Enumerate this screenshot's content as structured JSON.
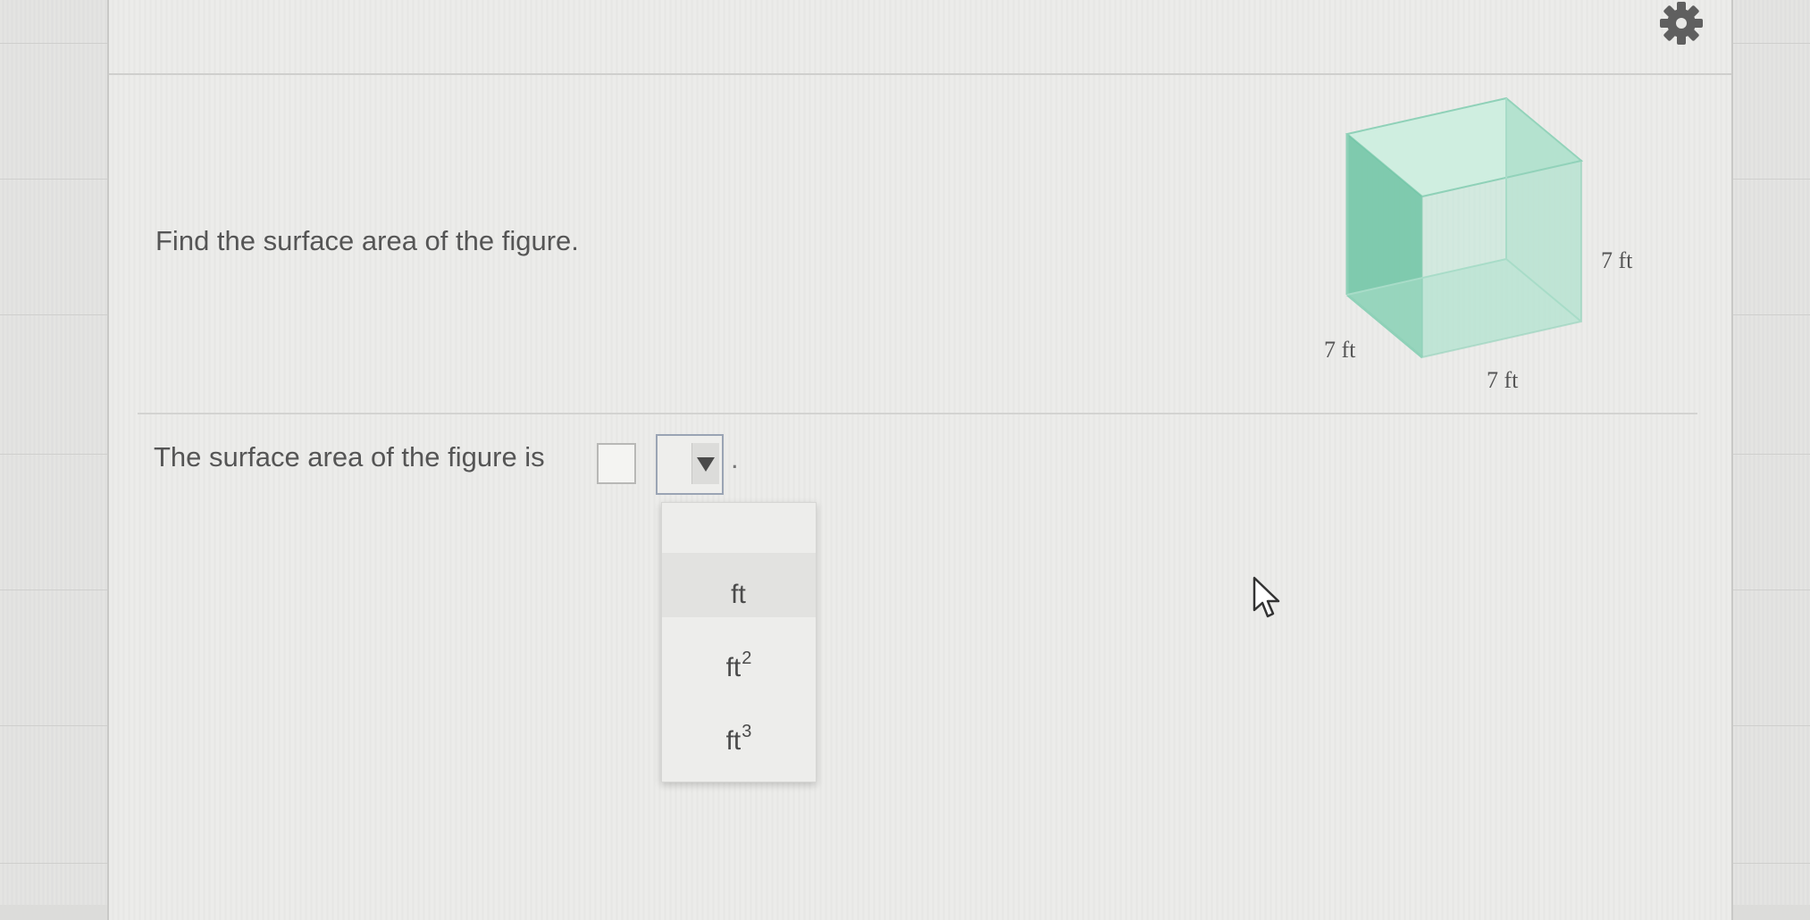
{
  "question": {
    "prompt": "Find the surface area of the figure.",
    "figure": {
      "shape": "cube",
      "height_label": "7 ft",
      "depth_label": "7 ft",
      "width_label": "7 ft",
      "face_color": "#8fd1b8",
      "edge_color": "#6cc4a3"
    }
  },
  "answer": {
    "sentence": "The surface area of the figure is",
    "value": "",
    "period": ".",
    "unit_dropdown": {
      "selected": "",
      "options": [
        {
          "base": "ft",
          "exponent": ""
        },
        {
          "base": "ft",
          "exponent": "2"
        },
        {
          "base": "ft",
          "exponent": "3"
        }
      ]
    }
  },
  "toolbar": {
    "settings_icon": "gear-icon"
  },
  "colors": {
    "text": "#555555",
    "panel": "#ececea"
  }
}
